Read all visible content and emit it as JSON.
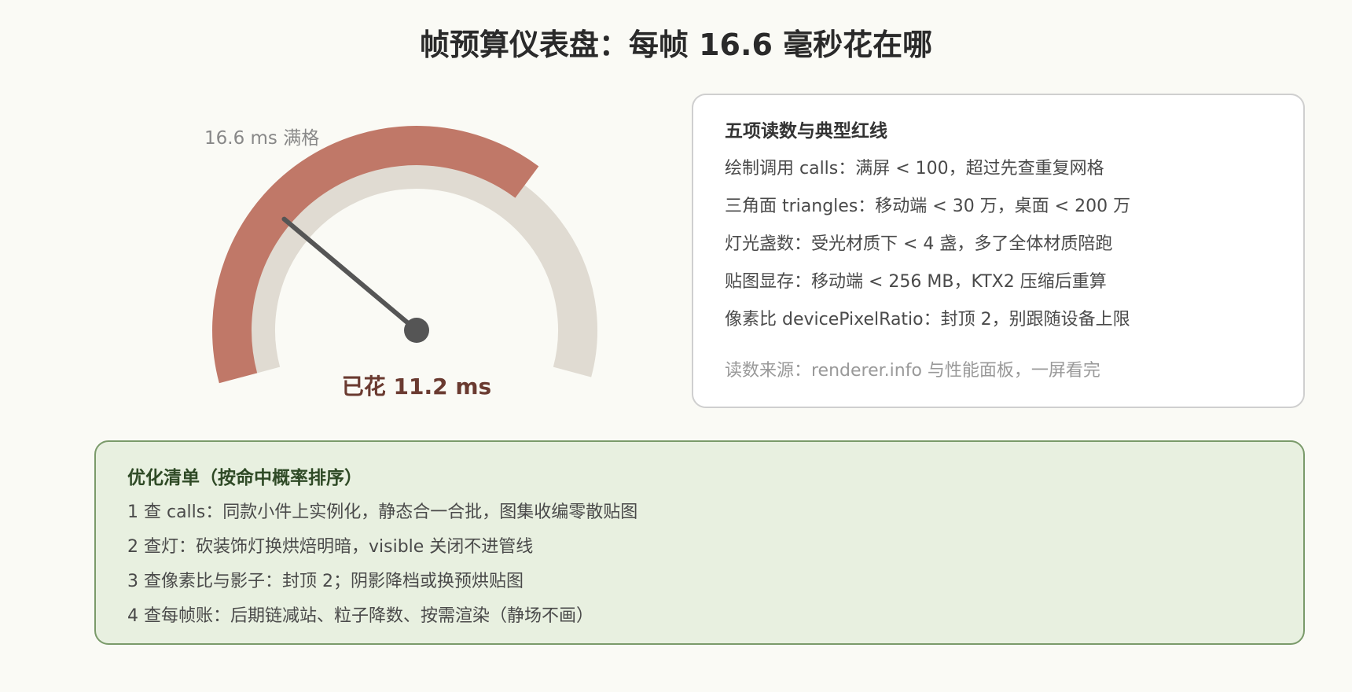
{
  "title": "帧预算仪表盘：每帧 16.6 毫秒花在哪",
  "gauge": {
    "full_scale_label": "16.6 ms 满格",
    "spent_label": "已花 11.2 ms",
    "full_scale_ms": 16.6,
    "spent_ms": 11.2,
    "colors": {
      "track": "#e0dbd2",
      "fill": "#c07868",
      "needle": "#555555",
      "spent_text": "#6a3a30"
    }
  },
  "readings": {
    "heading": "五项读数与典型红线",
    "items": [
      "绘制调用 calls：满屏 < 100，超过先查重复网格",
      "三角面 triangles：移动端 < 30 万，桌面 < 200 万",
      "灯光盏数：受光材质下 < 4 盏，多了全体材质陪跑",
      "贴图显存：移动端 < 256 MB，KTX2 压缩后重算",
      "像素比 devicePixelRatio：封顶 2，别跟随设备上限"
    ],
    "source": "读数来源：renderer.info 与性能面板，一屏看完"
  },
  "optimization": {
    "heading": "优化清单（按命中概率排序）",
    "items": [
      "1 查 calls：同款小件上实例化，静态合一合批，图集收编零散贴图",
      "2 查灯：砍装饰灯换烘焙明暗，visible 关闭不进管线",
      "3 查像素比与影子：封顶 2；阴影降档或换预烘贴图",
      "4 查每帧账：后期链减站、粒子降数、按需渲染（静场不画）"
    ],
    "colors": {
      "border": "#7a9a6a",
      "background": "#e8f0e0"
    }
  }
}
